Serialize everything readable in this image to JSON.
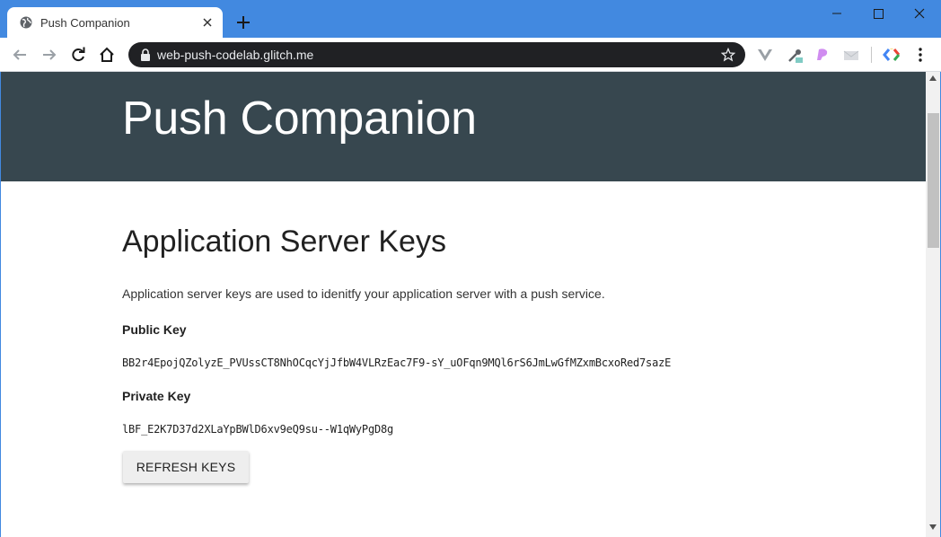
{
  "browser": {
    "tab_title": "Push Companion",
    "url": "web-push-codelab.glitch.me"
  },
  "page": {
    "hero_title": "Push Companion",
    "section_title": "Application Server Keys",
    "description": "Application server keys are used to idenitfy your application server with a push service.",
    "public_key_label": "Public Key",
    "public_key": "BB2r4EpojQZolyzE_PVUssCT8NhOCqcYjJfbW4VLRzEac7F9-sY_uOFqn9MQl6rS6JmLwGfMZxmBcxoRed7sazE",
    "private_key_label": "Private Key",
    "private_key": "lBF_E2K7D37d2XLaYpBWlD6xv9eQ9su--W1qWyPgD8g",
    "refresh_button_label": "REFRESH KEYS"
  },
  "colors": {
    "titlebar": "#4289e0",
    "hero": "#37474f",
    "omnibox": "#202124"
  }
}
